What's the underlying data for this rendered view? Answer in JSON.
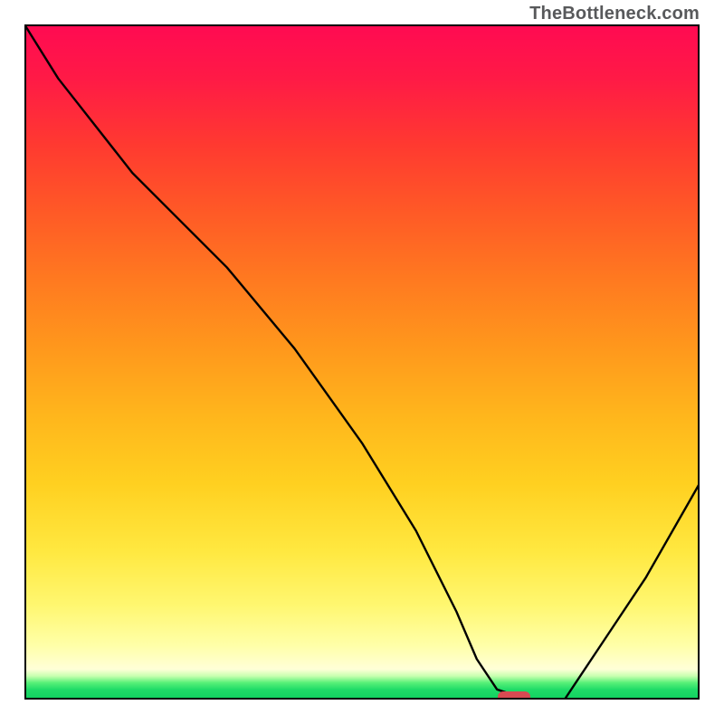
{
  "watermark": "TheBottleneck.com",
  "colors": {
    "frame": "#000000",
    "curve": "#000000",
    "marker": "#d94a52",
    "gradient_top": "#ff0a52",
    "gradient_mid": "#ffd020",
    "gradient_bottom": "#10d060"
  },
  "chart_data": {
    "type": "line",
    "title": "",
    "xlabel": "",
    "ylabel": "",
    "xlim": [
      0,
      100
    ],
    "ylim": [
      0,
      100
    ],
    "series": [
      {
        "name": "bottleneck-curve",
        "x": [
          0,
          5,
          16,
          24,
          30,
          40,
          50,
          58,
          64,
          67,
          70,
          74.5,
          80,
          86,
          92,
          100
        ],
        "values": [
          100,
          92,
          78,
          70,
          64,
          52,
          38,
          25,
          13,
          6,
          1.5,
          0,
          0,
          9,
          18,
          32
        ]
      }
    ],
    "marker": {
      "x_center": 72.5,
      "y": 0,
      "note": "optimal-range-indicator"
    },
    "grid": false,
    "legend": false
  }
}
